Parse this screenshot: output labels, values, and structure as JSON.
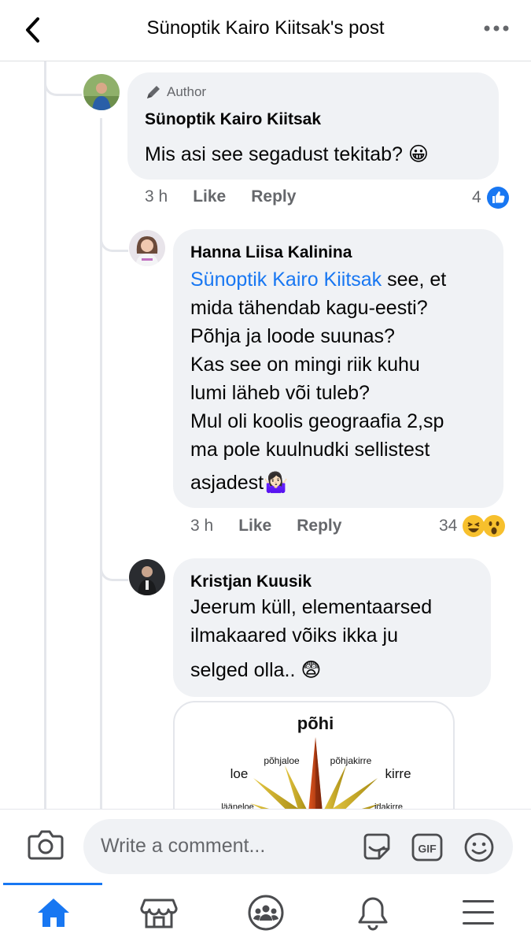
{
  "header": {
    "title": "Sünoptik Kairo Kiitsak's post"
  },
  "comments": [
    {
      "badge": "Author",
      "name": "Sünoptik Kairo Kiitsak",
      "text": "Mis asi see segadust tekitab? 😀",
      "time": "3 h",
      "like": "Like",
      "reply": "Reply",
      "reactions": "4"
    },
    {
      "name": "Hanna Liisa Kalinina",
      "mention": "Sünoptik Kairo Kiitsak",
      "lines": [
        " see, et",
        "mida tähendab kagu-eesti?",
        "Põhja ja loode suunas?",
        "Kas see on mingi riik kuhu",
        "lumi läheb või tuleb?",
        "Mul oli koolis geograafia 2,sp",
        "ma pole kuulnudki sellistest",
        "asjadest🤷🏻‍♀️"
      ],
      "time": "3 h",
      "like": "Like",
      "reply": "Reply",
      "reactions": "34"
    },
    {
      "name": "Kristjan Kuusik",
      "lines": [
        "Jeerum küll, elementaarsed",
        "ilmakaared võiks ikka ju",
        "selged olla.. 😨"
      ]
    }
  ],
  "compass": {
    "north": "põhi",
    "northwest": "loe",
    "northnorthwest": "põhjaloe",
    "northnortheast": "põhjakirre",
    "northeast": "kirre",
    "westnorthwest": "lääneloe",
    "eastnortheast": "idakirre"
  },
  "composer": {
    "placeholder": "Write a comment...",
    "gif": "GIF"
  },
  "icons": {
    "back": "chevron-left-icon",
    "more": "more-horizontal-icon",
    "camera": "camera-icon",
    "sticker": "sticker-icon",
    "gif": "gif-icon",
    "emoji": "smiley-icon",
    "home": "home-icon",
    "marketplace": "marketplace-icon",
    "groups": "groups-icon",
    "notifications": "bell-icon",
    "menu": "hamburger-menu-icon"
  },
  "colors": {
    "accent": "#1877f2",
    "bubble": "#f0f2f5",
    "secondary_text": "#65676b"
  }
}
